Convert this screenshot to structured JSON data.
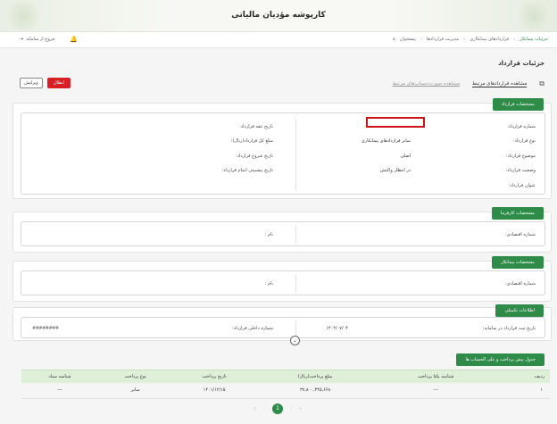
{
  "app": {
    "title": "کارپوشه مؤدیان مالیاتی"
  },
  "topbar": {
    "logout_label": "خروج از سامانه",
    "breadcrumbs": [
      "پیشخوان",
      "مدیریت قراردادها",
      "قراردادهای پیمانکاری",
      "جزئیات پیمانکار"
    ]
  },
  "page": {
    "title": "جزئیات قرارداد",
    "tabs": [
      "مشاهده قراردادهای مرتبط",
      "مشاهده صورت‌حساب‌های مرتبط"
    ],
    "cancel_label": "ابطال",
    "edit_label": "ویرایش"
  },
  "contract": {
    "header": "مشخصات قرارداد",
    "right": [
      {
        "label": "شماره قرارداد:",
        "value": ""
      },
      {
        "label": "نوع قرارداد:",
        "value": "سایر قراردادهای پیمانکاری"
      },
      {
        "label": "موضوع قرارداد:",
        "value": "اصلی"
      },
      {
        "label": "وضعیت قرارداد:",
        "value": "در انتظار واکنش"
      },
      {
        "label": "عنوان قرارداد:",
        "value": ""
      }
    ],
    "left": [
      {
        "label": "تاریخ عقد قرارداد:",
        "value": ""
      },
      {
        "label": "مبلغ کل قرارداد(ریال):",
        "value": ""
      },
      {
        "label": "تاریخ شروع قرارداد:",
        "value": ""
      },
      {
        "label": "تاریخ پیشبینی اتمام قرارداد:",
        "value": ""
      }
    ]
  },
  "employer": {
    "header": "مشخصات کارفرما",
    "economic_label": "شماره اقتصادی:",
    "name_label": "نام :"
  },
  "contractor": {
    "header": "مشخصات پیمانکار",
    "economic_label": "شماره اقتصادی:",
    "name_label": "نام :"
  },
  "extra": {
    "header": "اطلاعات تکمیلی",
    "reg_date_label": "تاریخ ثبت قرارداد در سامانه:",
    "reg_date_value": "۱۴۰۲/۰۷/۰۴",
    "internal_label": "شماره داخلی قرارداد:",
    "internal_value": "########"
  },
  "payments": {
    "header": "جدول پیش پرداخت و علی الحساب ها",
    "columns": [
      "ردیف",
      "شناسه یکتا پرداخت",
      "مبلغ پرداخت(ریال)",
      "تاریخ پرداخت",
      "نوع پرداخت",
      "شناسه سیاد"
    ],
    "rows": [
      [
        "۱",
        "---",
        "۳۷,۸۰۰,۳۴۵,۶۶۸",
        "۱۴۰۱/۱۲/۱۵",
        "سایر",
        "---"
      ]
    ]
  },
  "pager": {
    "first": "«",
    "prev": "‹",
    "current": "1",
    "next": "›",
    "last": "»"
  },
  "colors": {
    "accent": "#2e8b48",
    "danger": "#d81f26",
    "highlight": "#c9141c"
  },
  "icons": [
    "logout-icon",
    "bell-icon",
    "home-icon",
    "copy-icon",
    "chevron-down-icon"
  ]
}
